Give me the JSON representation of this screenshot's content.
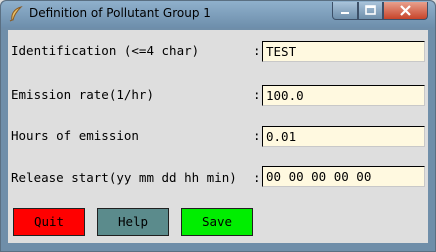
{
  "window": {
    "title": "Definition of Pollutant Group 1",
    "controls": {
      "minimize": "—",
      "maximize": "▢",
      "close": "✕"
    }
  },
  "icons": {
    "app": "feather-icon"
  },
  "form": {
    "rows": [
      {
        "label": "Identification (<=4 char)",
        "colon": ":",
        "value": "TEST"
      },
      {
        "label": "Emission rate(1/hr)",
        "colon": ":",
        "value": "100.0"
      },
      {
        "label": "Hours of emission",
        "colon": ":",
        "value": "0.01"
      },
      {
        "label": "Release start(yy mm dd hh min)",
        "colon": ":",
        "value": "00 00 00 00 00"
      }
    ]
  },
  "buttons": {
    "quit": "Quit",
    "help": "Help",
    "save": "Save"
  },
  "colors": {
    "quit": "#ff0000",
    "help": "#5b8b8c",
    "save": "#00ee00",
    "field_bg": "#fff9e0",
    "window_bg": "#dedede"
  }
}
